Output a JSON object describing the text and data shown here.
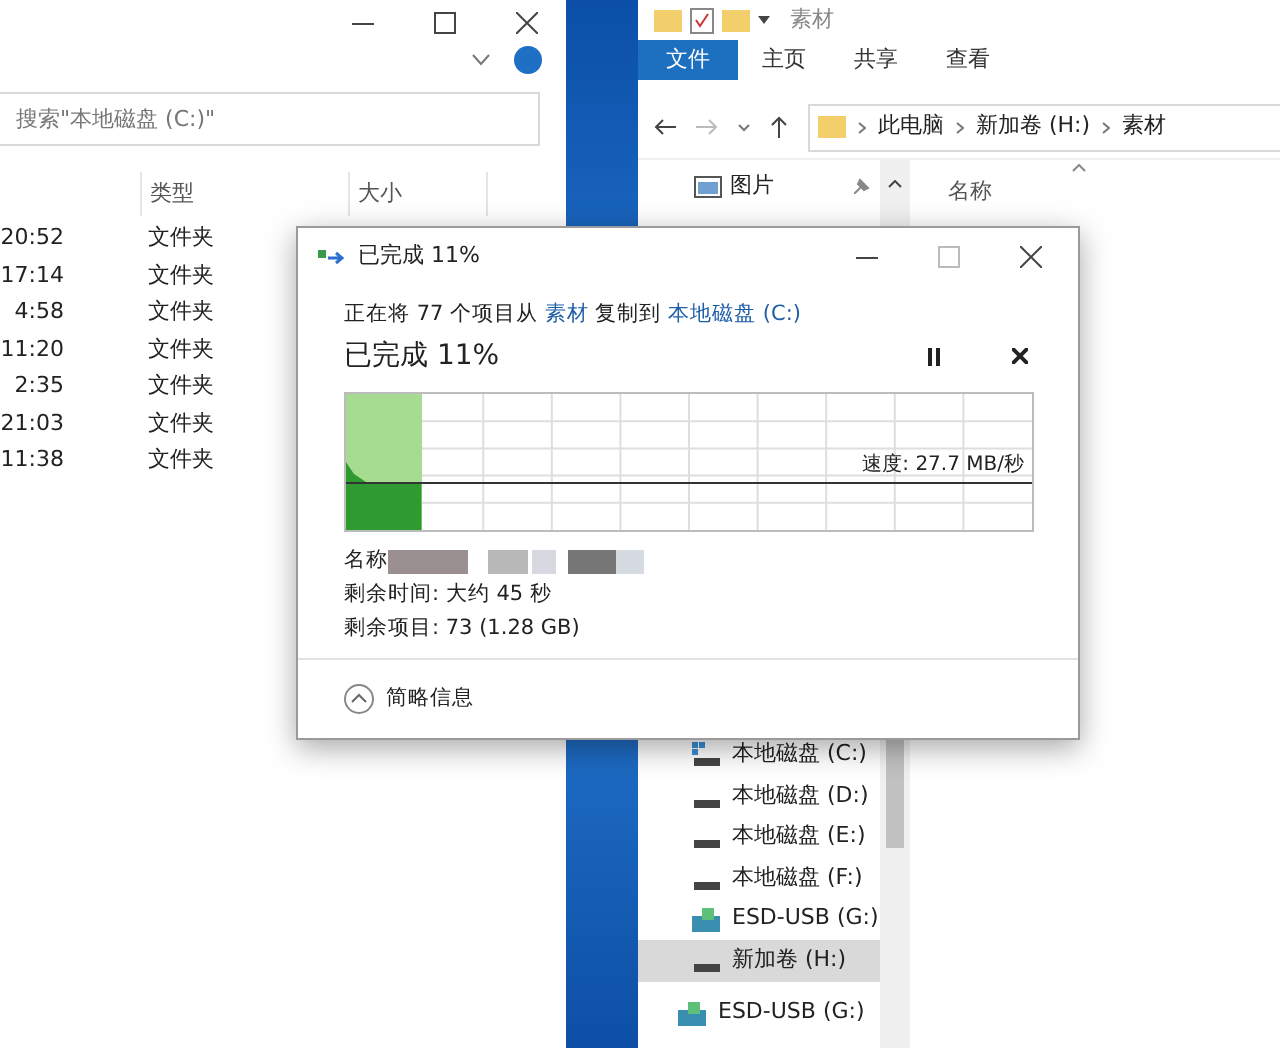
{
  "left_window": {
    "search": {
      "placeholder": "搜索\"本地磁盘 (C:)\""
    },
    "columns": [
      "类型",
      "大小"
    ],
    "rows": [
      {
        "time": "20:52",
        "type": "文件夹"
      },
      {
        "time": "17:14",
        "type": "文件夹"
      },
      {
        "time": "4:58",
        "type": "文件夹"
      },
      {
        "time": "11:20",
        "type": "文件夹"
      },
      {
        "time": "2:35",
        "type": "文件夹"
      },
      {
        "time": "21:03",
        "type": "文件夹"
      },
      {
        "time": "11:38",
        "type": "文件夹"
      }
    ]
  },
  "right_window": {
    "title": "素材",
    "ribbon_tabs": [
      {
        "label": "文件",
        "selected": true
      },
      {
        "label": "主页",
        "selected": false
      },
      {
        "label": "共享",
        "selected": false
      },
      {
        "label": "查看",
        "selected": false
      }
    ],
    "breadcrumb": [
      "此电脑",
      "新加卷 (H:)",
      "素材"
    ],
    "nav_top": [
      {
        "label": "图片",
        "kind": "pictures"
      }
    ],
    "column": "名称",
    "nav_bottom": [
      {
        "label": "本地磁盘 (C:)",
        "kind": "system",
        "selected": false
      },
      {
        "label": "本地磁盘 (D:)",
        "kind": "drive",
        "selected": false
      },
      {
        "label": "本地磁盘 (E:)",
        "kind": "drive",
        "selected": false
      },
      {
        "label": "本地磁盘 (F:)",
        "kind": "drive",
        "selected": false
      },
      {
        "label": "ESD-USB (G:)",
        "kind": "usb",
        "selected": false
      },
      {
        "label": "新加卷 (H:)",
        "kind": "drive",
        "selected": true
      }
    ],
    "nav_last": {
      "label": "ESD-USB (G:)",
      "kind": "usb"
    }
  },
  "dialog": {
    "title": "已完成 11%",
    "message": {
      "prefix": "正在将 77 个项目从",
      "source": "素材",
      "middle": "复制到",
      "dest": "本地磁盘 (C:)"
    },
    "heading": "已完成 11%",
    "progress": {
      "level": 0.11
    },
    "speed": "速度: 27.7 MB/秒",
    "name_label": "名称",
    "time_left": "剩余时间: 大约 45 秒",
    "items_left": "剩余项目: 73 (1.28 GB)",
    "toggle": "简略信息"
  }
}
